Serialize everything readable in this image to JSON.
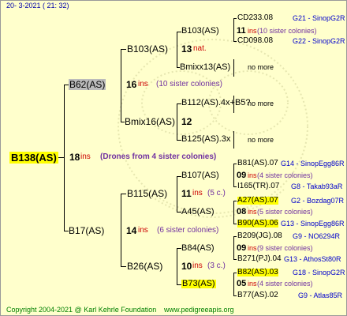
{
  "header": {
    "datetime": "20- 3-2021 ( 21: 32)"
  },
  "footer": {
    "copyright": "Copyright 2004-2021 @ Karl Kehrle Foundation",
    "site": "www.pedigreeapis.org"
  },
  "root": {
    "id": "B138(AS)",
    "num": "18",
    "ins": "ins",
    "note": "(Drones from 4 sister colonies)"
  },
  "gen1": {
    "top": {
      "id": "B62(AS)",
      "num": "16",
      "ins": "ins",
      "note": "(10 sister colonies)"
    },
    "bottom": {
      "id": "B17(AS)",
      "num": "14",
      "ins": "ins",
      "note": "(6 sister colonies)"
    }
  },
  "gen2": {
    "a": {
      "id": "B103(AS)",
      "num": "13",
      "ins": "nat."
    },
    "b": {
      "id": "Bmix16(AS)",
      "num": "12"
    },
    "c": {
      "id": "B115(AS)",
      "num": "11",
      "ins": "ins",
      "note": "(5 c.)"
    },
    "d": {
      "id": "B26(AS)",
      "num": "10",
      "ins": "ins",
      "note": "(3 c.)"
    }
  },
  "gen3": {
    "a": {
      "id": "B103(AS)",
      "num": "11",
      "ins": "ins",
      "note": "(10 sister colonies)"
    },
    "b": {
      "id": "Bmixx13(AS)"
    },
    "c": {
      "id": "B112(AS).4x+B5?"
    },
    "d": {
      "id": "B125(AS).3x"
    },
    "e": {
      "id": "B107(AS)",
      "num": "09",
      "ins": "ins",
      "note": "(4 sister colonies)"
    },
    "f": {
      "id": "A45(AS)",
      "num": "08",
      "ins": "ins",
      "note": "(5 sister colonies)"
    },
    "g": {
      "id": "B84(AS)",
      "num": "09",
      "ins": "ins",
      "note": "(9 sister colonies)"
    },
    "h": {
      "id": "B73(AS)",
      "num": "05",
      "ins": "ins",
      "note": "(4 sister colonies)"
    }
  },
  "gen4": [
    {
      "id": "CD233.08",
      "ref": "G21 - SinopG2R"
    },
    {
      "id": "CD098.08",
      "ref": "G22 - SinopG2R"
    },
    {
      "id": "no more"
    },
    {
      "id": "no more"
    },
    {
      "id": "no more"
    },
    {
      "id": "B81(AS).07",
      "ref": "G14 - SinopEgg86R"
    },
    {
      "id": "I165(TR).07",
      "ref": "G8 - Takab93aR"
    },
    {
      "id": "A27(AS).07",
      "ref": "G2 - Bozdag07R"
    },
    {
      "id": "B90(AS).06",
      "ref": "G13 - SinopEgg86R"
    },
    {
      "id": "B209(JG).08",
      "ref": "G9 - NO6294R"
    },
    {
      "id": "B271(PJ).04",
      "ref": "G13 - AthosSt80R"
    },
    {
      "id": "B82(AS).03",
      "ref": "G18 - SinopG2R"
    },
    {
      "id": "B77(AS).02",
      "ref": "G9 - Atlas85R"
    }
  ]
}
